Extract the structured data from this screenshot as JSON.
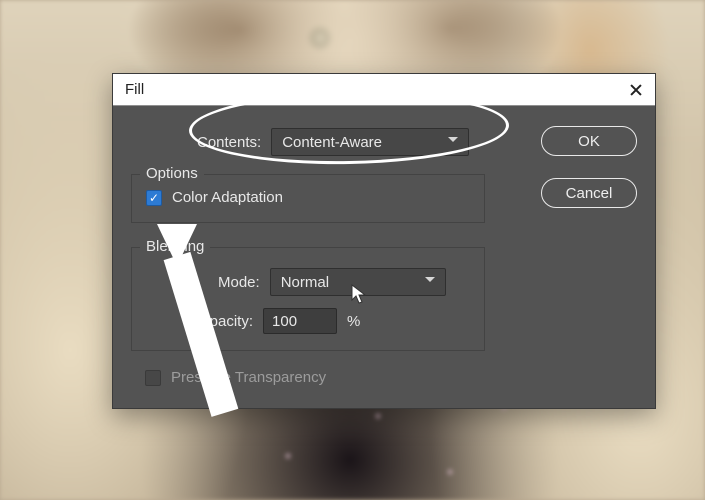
{
  "dialog": {
    "title": "Fill",
    "contents_label": "Contents:",
    "contents_value": "Content-Aware",
    "options_legend": "Options",
    "color_adaptation_label": "Color Adaptation",
    "color_adaptation_checked": true,
    "blending_legend": "Blending",
    "mode_label": "Mode:",
    "mode_value": "Normal",
    "opacity_label": "Opacity:",
    "opacity_value": "100",
    "opacity_unit": "%",
    "preserve_transparency_label": "Preserve Transparency",
    "preserve_transparency_enabled": false,
    "buttons": {
      "ok": "OK",
      "cancel": "Cancel"
    }
  }
}
